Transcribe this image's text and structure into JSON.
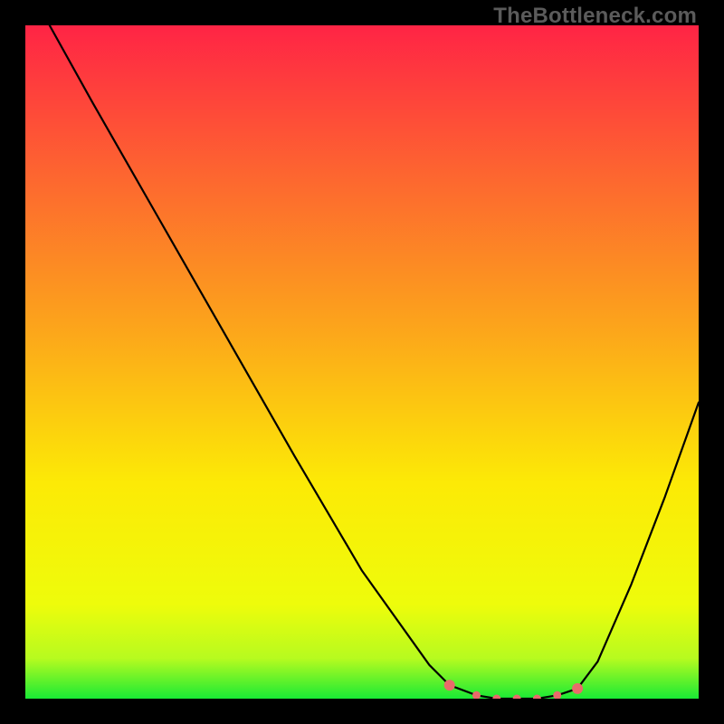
{
  "watermark": "TheBottleneck.com",
  "colors": {
    "black": "#000000",
    "curve": "#000000",
    "dot": "#e96a6a",
    "green": "#19ea35",
    "greenYellow": "#b7fb1f",
    "yellow": "#fcea06",
    "orange": "#fca51b",
    "redOrange": "#fd6530",
    "red": "#ff2445",
    "watermark": "#5b5b5b"
  },
  "chart_data": {
    "type": "line",
    "title": "",
    "xlabel": "",
    "ylabel": "",
    "xlim": [
      0,
      100
    ],
    "ylim": [
      0,
      100
    ],
    "series": [
      {
        "name": "bottleneck-curve",
        "x": [
          3.6,
          10,
          20,
          30,
          40,
          50,
          60,
          63,
          67,
          70,
          73,
          76,
          79,
          82,
          85,
          90,
          95,
          100
        ],
        "y": [
          100,
          88.5,
          71,
          53.5,
          36,
          19,
          5,
          2,
          0.5,
          0,
          0,
          0,
          0.5,
          1.5,
          5.5,
          17,
          30,
          44
        ]
      }
    ],
    "highlighted_points": {
      "name": "optimal-band-dots",
      "x": [
        63,
        67,
        70,
        73,
        76,
        79,
        82
      ],
      "y": [
        2,
        0.5,
        0,
        0,
        0,
        0.5,
        1.5
      ]
    }
  }
}
